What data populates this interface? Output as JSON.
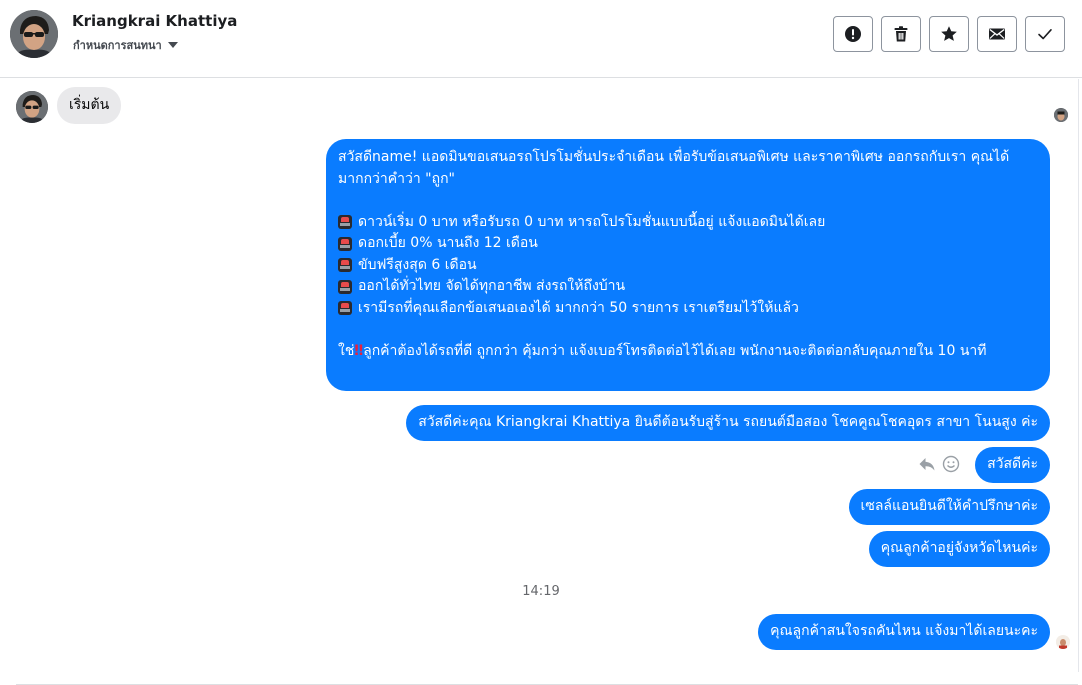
{
  "header": {
    "contact_name": "Kriangkrai Khattiya",
    "subtitle": "กำหนดการสนทนา",
    "toolbar": {
      "alert_icon": "exclamation-circle-icon",
      "delete_icon": "trash-icon",
      "star_icon": "star-icon",
      "mail_icon": "envelope-icon",
      "done_icon": "checkmark-icon"
    }
  },
  "conversation": {
    "start_label": "เริ่มต้น",
    "message_1": {
      "greeting": "สวัสดีname! แอดมินขอเสนอรถโปรโมชั่นประจำเดือน เพื่อรับข้อเสนอพิเศษ และราคาพิเศษ ออกรถกับเรา คุณได้มากกว่าคำว่า \"ถูก\"",
      "bullets": [
        "ดาวน์เริ่ม 0 บาท หรือรับรถ 0 บาท หารถโปรโมชั่นแบบนี้อยู่ แจ้งแอดมินได้เลย",
        "ดอกเบี้ย 0% นานถึง 12 เดือน",
        "ขับฟรีสูงสุด 6 เดือน",
        "ออกได้ทั่วไทย จัดได้ทุกอาชีพ ส่งรถให้ถึงบ้าน",
        "เรามีรถที่คุณเลือกข้อเสนอเองได้ มากกว่า 50 รายการ เราเตรียมไว้ให้แล้ว"
      ],
      "closing_prefix": "ใช่",
      "closing_mark": "‼",
      "closing_rest": "ลูกค้าต้องได้รถที่ดี ถูกกว่า คุ้มกว่า แจ้งเบอร์โทรติดต่อไว้ได้เลย พนักงานจะติดต่อกลับคุณภายใน 10 นาที"
    },
    "message_2": "สวัสดีค่ะคุณ Kriangkrai Khattiya ยินดีต้อนรับสู่ร้าน รถยนต์มือสอง โชคคูณโชคอุดร สาขา โนนสูง ค่ะ",
    "message_3": "สวัสดีค่ะ",
    "message_4": "เซลล์แอนยินดีให้คำปรึกษาค่ะ",
    "message_5": "คุณลูกค้าอยู่จังหวัดไหนค่ะ",
    "timestamp": "14:19",
    "message_6": "คุณลูกค้าสนใจรถคันไหน แจ้งมาได้เลยนะคะ"
  },
  "colors": {
    "outgoing_bubble": "#0a7cff",
    "incoming_bubble": "#e9e9eb",
    "alert_mark": "#e8213e"
  }
}
